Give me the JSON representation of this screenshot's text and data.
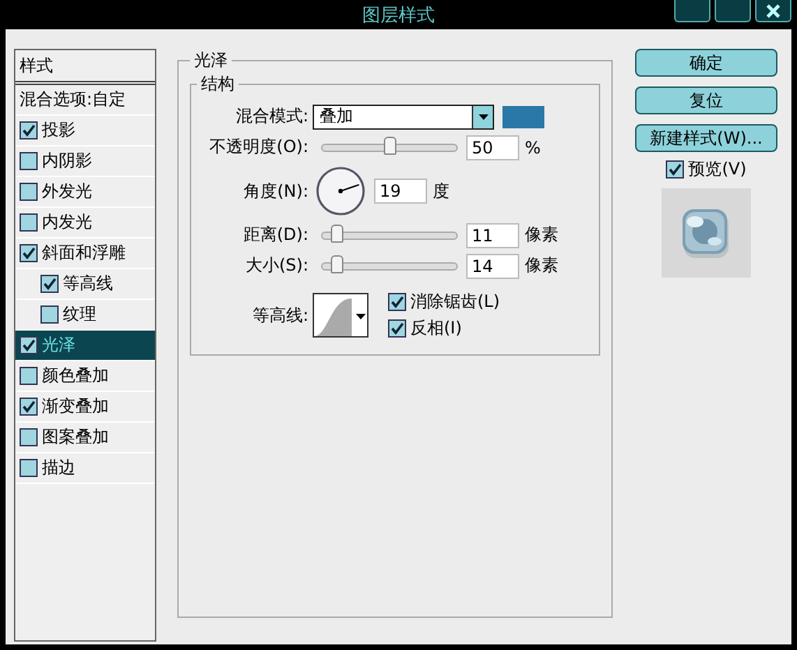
{
  "window": {
    "title": "图层样式"
  },
  "sidebar": {
    "header": "样式",
    "blend_options": "混合选项:自定",
    "items": [
      {
        "label": "投影",
        "checked": true,
        "selected": false
      },
      {
        "label": "内阴影",
        "checked": false,
        "selected": false
      },
      {
        "label": "外发光",
        "checked": false,
        "selected": false
      },
      {
        "label": "内发光",
        "checked": false,
        "selected": false
      },
      {
        "label": "斜面和浮雕",
        "checked": true,
        "selected": false,
        "children": [
          {
            "label": "等高线",
            "checked": true,
            "selected": false
          },
          {
            "label": "纹理",
            "checked": false,
            "selected": false
          }
        ]
      },
      {
        "label": "光泽",
        "checked": true,
        "selected": true
      },
      {
        "label": "颜色叠加",
        "checked": false,
        "selected": false
      },
      {
        "label": "渐变叠加",
        "checked": true,
        "selected": false
      },
      {
        "label": "图案叠加",
        "checked": false,
        "selected": false
      },
      {
        "label": "描边",
        "checked": false,
        "selected": false
      }
    ]
  },
  "panel": {
    "title": "光泽",
    "group_title": "结构",
    "blend_mode": {
      "label": "混合模式:",
      "value": "叠加",
      "color": "#2a78a8"
    },
    "opacity": {
      "label": "不透明度(O):",
      "level": 0.5,
      "value": "50",
      "unit": "%"
    },
    "angle": {
      "label": "角度(N):",
      "value": "19",
      "unit": "度"
    },
    "distance": {
      "label": "距离(D):",
      "level": 0.1,
      "value": "11",
      "unit": "像素"
    },
    "size": {
      "label": "大小(S):",
      "level": 0.1,
      "value": "14",
      "unit": "像素"
    },
    "contour": {
      "label": "等高线:"
    },
    "options": [
      {
        "label": "消除锯齿(L)",
        "checked": true
      },
      {
        "label": "反相(I)",
        "checked": true
      }
    ]
  },
  "buttons": [
    "确定",
    "复位",
    "新建样式(W)..."
  ],
  "preview": {
    "label": "预览(V)",
    "checked": true
  }
}
